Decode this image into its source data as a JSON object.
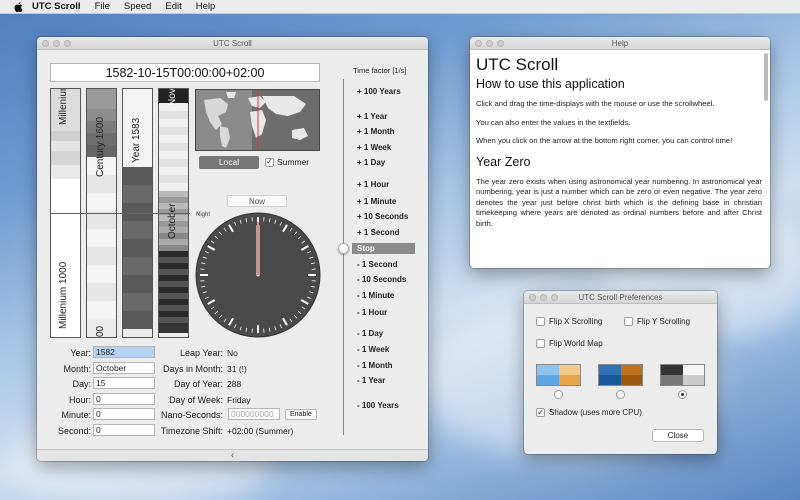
{
  "menubar": {
    "app_name": "UTC Scroll",
    "items": [
      "File",
      "Speed",
      "Edit",
      "Help"
    ]
  },
  "main_window": {
    "title": "UTC Scroll",
    "datetime": "1582-10-15T00:00:00+02:00",
    "scales": {
      "millenium_top": "Millenium",
      "millenium_bottom": "Millenium 1000",
      "century": "Century 1600",
      "century_bottom": "00",
      "year": "Year 1583",
      "month_top": "Nov",
      "month": "October"
    },
    "local_button": "Local",
    "summer_label": "Summer",
    "summer_checked": true,
    "now_button": "Now",
    "night_label": "Night",
    "fields": {
      "year_label": "Year:",
      "year_value": "1582",
      "month_label": "Month:",
      "month_value": "October",
      "day_label": "Day:",
      "day_value": "15",
      "hour_label": "Hour:",
      "hour_value": "0",
      "minute_label": "Minute:",
      "minute_value": "0",
      "second_label": "Second:",
      "second_value": "0"
    },
    "info": {
      "leap_label": "Leap Year:",
      "leap_value": "No",
      "days_month_label": "Days in Month:",
      "days_month_value": "31 (!)",
      "day_of_year_label": "Day of Year:",
      "day_of_year_value": "288",
      "day_of_week_label": "Day of Week:",
      "day_of_week_value": "Friday",
      "nano_label": "Nano-Seconds:",
      "nano_placeholder": "000000000",
      "enable_button": "Enable",
      "tz_label": "Timezone Shift:",
      "tz_value": "+02:00 (Summer)"
    },
    "time_factor": {
      "title": "Time factor [1/s]",
      "items": [
        "+ 100 Years",
        "+ 1 Year",
        "+ 1 Month",
        "+ 1 Week",
        "+ 1 Day",
        "+ 1 Hour",
        "+ 1 Minute",
        "+ 10 Seconds",
        "+ 1 Second",
        "Stop",
        "- 1 Second",
        "- 10 Seconds",
        "- 1 Minute",
        "- 1 Hour",
        "- 1 Day",
        "- 1 Week",
        "- 1 Month",
        "- 1 Year",
        "- 100 Years"
      ],
      "selected": "Stop"
    },
    "collapse_arrow": "‹"
  },
  "help_window": {
    "title": "Help",
    "heading": "UTC Scroll",
    "subheading1": "How to use this application",
    "p1": "Click and drag the time-displays with the mouse or use the scrollwheel.",
    "p2": "You can also enter the values in the textfields.",
    "p3": "When you click on the arrow at the bottom right corner, you can control time!",
    "subheading2": "Year Zero",
    "p4": "The year zero exists when using astronomical year numbering. In astronomical year numbering, year is just a number which can be zero or even negative. The year zero denotes the year just before christ birth which is the defining base in christian timekeeping where years are denoted as ordinal numbers before and after Christ birth."
  },
  "prefs_window": {
    "title": "UTC Scroll Preferences",
    "flip_x": "Flip X Scrolling",
    "flip_y": "Flip Y Scrolling",
    "flip_map": "Flip World Map",
    "shadow": "Shadow (uses more CPU)",
    "shadow_checked": true,
    "selected_theme": 3,
    "close_button": "Close"
  }
}
